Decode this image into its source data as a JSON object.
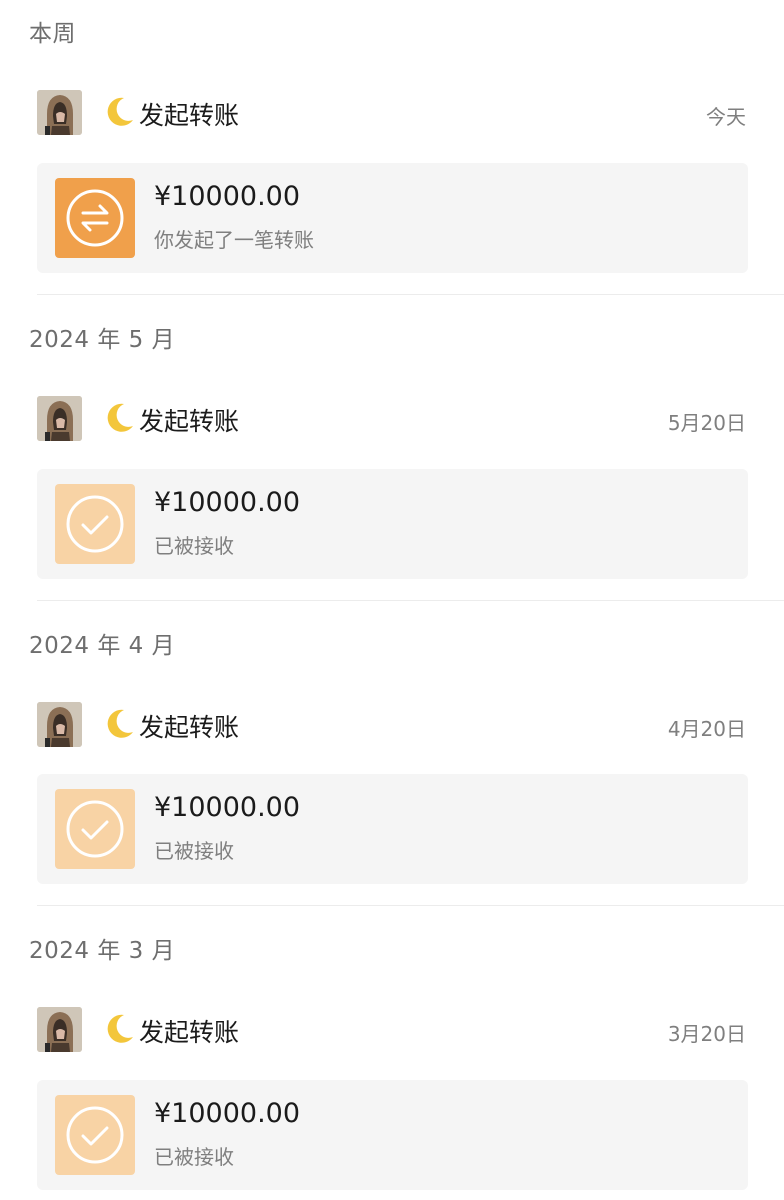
{
  "colors": {
    "accent_orange": "#f0a04b",
    "accent_light": "#f8d3a5",
    "card_bg": "#f5f5f5",
    "text_primary": "#1b1b1b",
    "text_secondary": "#7f7f7f"
  },
  "sections": [
    {
      "header": "本周",
      "entries": [
        {
          "title": "发起转账",
          "emoji": "crescent-moon-icon",
          "date": "今天",
          "amount": "¥10000.00",
          "status": "你发起了一笔转账",
          "icon": "transfer-arrows-icon"
        }
      ]
    },
    {
      "header": "2024 年 5 月",
      "entries": [
        {
          "title": "发起转账",
          "emoji": "crescent-moon-icon",
          "date": "5月20日",
          "amount": "¥10000.00",
          "status": "已被接收",
          "icon": "checkmark-circle-icon"
        }
      ]
    },
    {
      "header": "2024 年 4 月",
      "entries": [
        {
          "title": "发起转账",
          "emoji": "crescent-moon-icon",
          "date": "4月20日",
          "amount": "¥10000.00",
          "status": "已被接收",
          "icon": "checkmark-circle-icon"
        }
      ]
    },
    {
      "header": "2024 年 3 月",
      "entries": [
        {
          "title": "发起转账",
          "emoji": "crescent-moon-icon",
          "date": "3月20日",
          "amount": "¥10000.00",
          "status": "已被接收",
          "icon": "checkmark-circle-icon"
        }
      ]
    }
  ]
}
